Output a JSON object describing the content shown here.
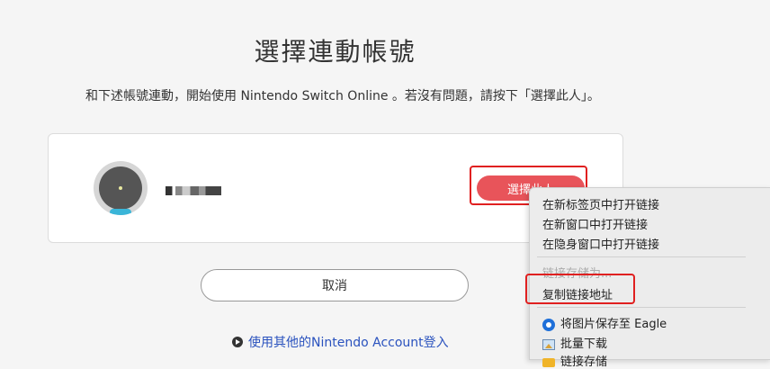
{
  "page": {
    "title": "選擇連動帳號",
    "intro": "和下述帳號連動，開始使用 Nintendo Switch Online 。若沒有問題，請按下「選擇此人」。"
  },
  "account_card": {
    "select_label": "選擇此人"
  },
  "cancel_label": "取消",
  "other_account_link": "使用其他的Nintendo Account登入",
  "context_menu": {
    "open_new_tab": "在新标签页中打开链接",
    "open_new_window": "在新窗口中打开链接",
    "open_incognito": "在隐身窗口中打开链接",
    "save_link_as": "链接存储为...",
    "copy_link": "复制链接地址",
    "save_to_eagle": "将图片保存至 Eagle",
    "batch_download": "批量下载",
    "partial_last": "链接存储"
  },
  "colors": {
    "accent": "#e8545a",
    "highlight": "#e02020",
    "link": "#2a52be"
  }
}
